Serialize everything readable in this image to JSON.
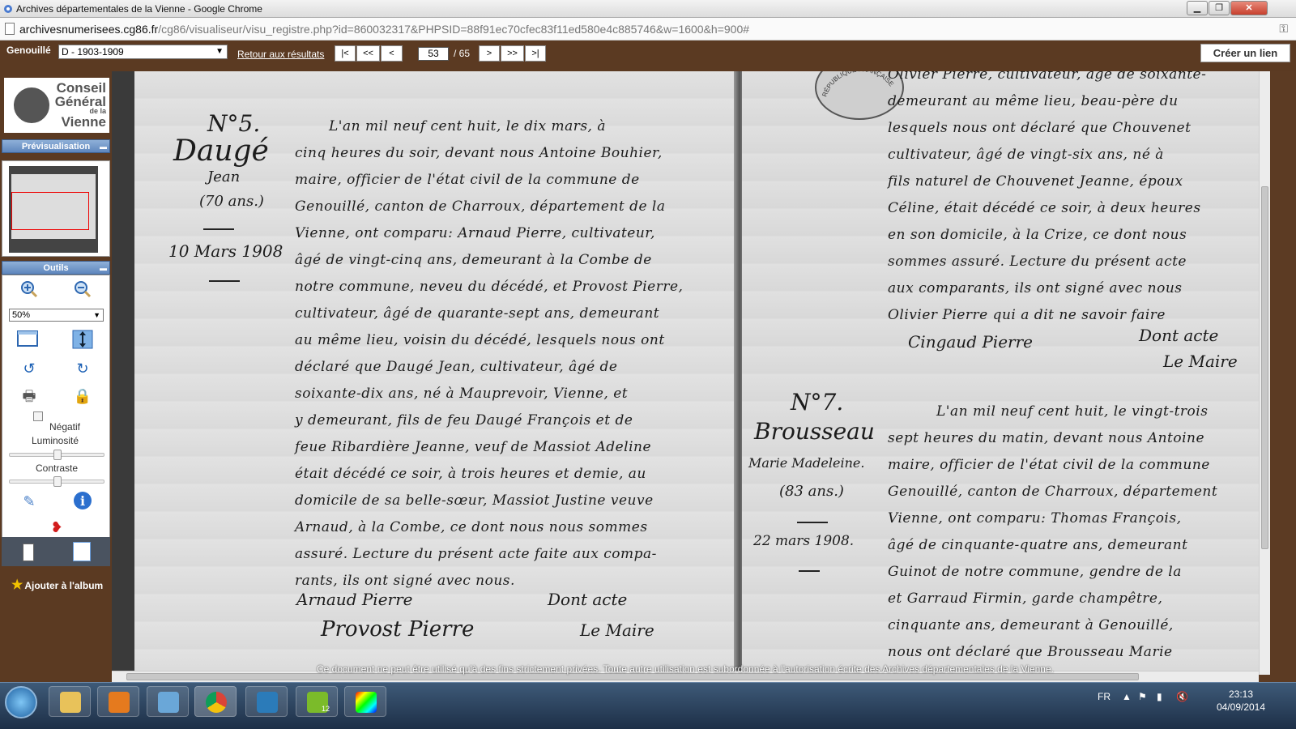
{
  "window": {
    "title": "Archives départementales de la Vienne - Google Chrome",
    "buttons": {
      "minimize": "▁",
      "restore": "❐",
      "close": "✕"
    }
  },
  "urlbar": {
    "url_domain": "archivesnumerisees.cg86.fr",
    "url_path": "/cg86/visualiseur/visu_registre.php?id=860032317&PHPSID=88f91ec70cfec83f11ed580e4c885746&w=1600&h=900#",
    "key_icon": "key-icon"
  },
  "toolbar": {
    "commune": "Genouillé",
    "register_select": "D - 1903-1909",
    "back_link": "Retour aux résultats",
    "nav": {
      "first": "|<",
      "prev_many": "<<",
      "prev": "<",
      "next": ">",
      "next_many": ">>",
      "last": ">|"
    },
    "page_current": "53",
    "page_total": "/ 65",
    "create_link": "Créer un lien"
  },
  "left_panel": {
    "logo": {
      "line1": "Conseil",
      "line2": "Général",
      "line3": "de la",
      "line4": "Vienne"
    },
    "preview_title": "Prévisualisation",
    "tools_title": "Outils",
    "zoom_level": "50%",
    "negative_label": "Négatif",
    "brightness_label": "Luminosité",
    "contrast_label": "Contraste",
    "brightness_value": 0.5,
    "contrast_value": 0.5,
    "album_label": "Ajouter à l'album"
  },
  "document": {
    "left_margin": {
      "num": "N°5.",
      "name": "Daugé",
      "first": "Jean",
      "age": "(70 ans.)",
      "date": "10 Mars 1908"
    },
    "left_lines": [
      "L'an mil neuf cent huit, le dix mars, à",
      "cinq heures du soir, devant nous Antoine Bouhier,",
      "maire, officier de l'état civil de la commune de",
      "Genouillé, canton de Charroux, département de la",
      "Vienne, ont comparu: Arnaud Pierre, cultivateur,",
      "âgé de vingt-cinq ans, demeurant à la Combe de",
      "notre commune, neveu du décédé, et Provost Pierre,",
      "cultivateur, âgé de quarante-sept ans, demeurant",
      "au même lieu, voisin du décédé, lesquels nous ont",
      "déclaré que Daugé Jean, cultivateur, âgé de",
      "soixante-dix ans, né à Mauprevoir, Vienne, et",
      "y demeurant, fils de feu Daugé François et de",
      "feue Ribardière Jeanne, veuf de Massiot Adeline",
      "était décédé ce soir, à trois heures et demie, au",
      "domicile de sa belle-sœur, Massiot Justine veuve",
      "Arnaud, à la Combe, ce dont nous nous sommes",
      "assuré. Lecture du présent acte faite aux compa-",
      "rants, ils ont signé avec nous."
    ],
    "left_signatures": {
      "sig1": "Arnaud Pierre",
      "sig2": "Provost Pierre",
      "dont": "Dont acte",
      "maire": "Le Maire"
    },
    "right_margin": {
      "num": "N°7.",
      "name": "Brousseau",
      "first": "Marie Madeleine.",
      "age": "(83 ans.)",
      "date": "22 mars 1908."
    },
    "right_lines_top": [
      "Olivier Pierre, cultivateur, âgé de soixante-",
      "demeurant au même lieu, beau-père du",
      "lesquels nous ont déclaré que Chouvenet",
      "cultivateur, âgé de vingt-six ans, né à",
      "fils naturel de Chouvenet Jeanne, époux",
      "Céline, était décédé ce soir, à deux heures",
      "en son domicile, à la Crize, ce dont nous",
      "sommes assuré. Lecture du présent acte",
      "aux comparants, ils ont signé avec nous",
      "Olivier Pierre qui a dit ne savoir faire"
    ],
    "right_signatures": {
      "sig1": "Cingaud Pierre",
      "dont": "Dont acte",
      "maire": "Le Maire"
    },
    "right_lines_bottom": [
      "L'an mil neuf cent huit, le vingt-trois",
      "sept heures du matin, devant nous Antoine",
      "maire, officier de l'état civil de la commune",
      "Genouillé, canton de Charroux, département",
      "Vienne, ont comparu: Thomas François,",
      "âgé de cinquante-quatre ans, demeurant",
      "Guinot de notre commune, gendre de la",
      "et Garraud Firmin, garde champêtre,",
      "cinquante ans, demeurant à Genouillé,",
      "nous ont déclaré que Brousseau Marie"
    ],
    "seal_text": "RÉPUBLIQUE FRANÇAISE"
  },
  "notice": "Ce document ne peut être utilisé qu'à des fins strictement privées. Toute autre utilisation est subordonnée à l'autorisation écrite des Archives départementales de la Vienne.",
  "taskbar": {
    "lang": "FR",
    "time": "23:13",
    "date": "04/09/2014",
    "badge": "12"
  }
}
